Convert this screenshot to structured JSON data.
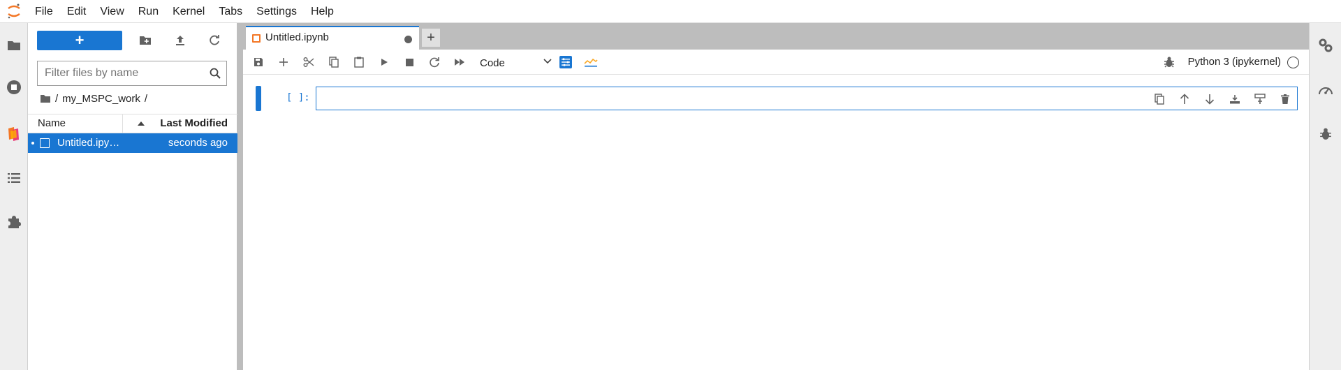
{
  "menubar": {
    "logo_icon": "jupyter-logo-icon",
    "items": [
      "File",
      "Edit",
      "View",
      "Run",
      "Kernel",
      "Tabs",
      "Settings",
      "Help"
    ]
  },
  "left_sidebar": {
    "icons": [
      "folder-icon",
      "running-sessions-icon",
      "extension-colored-icon",
      "table-of-contents-icon",
      "puzzle-extension-icon"
    ]
  },
  "file_browser": {
    "new_button_label": "+",
    "toolbar_icons": [
      "new-folder-icon",
      "upload-icon",
      "refresh-icon"
    ],
    "filter_placeholder": "Filter files by name",
    "breadcrumb": {
      "root_separator": "/",
      "folder": "my_MSPC_work",
      "trailing_separator": "/"
    },
    "columns": {
      "name": "Name",
      "last_modified": "Last Modified"
    },
    "files": [
      {
        "name": "Untitled.ipynb",
        "display_name": "Untitled.ipy…",
        "modified": "seconds ago",
        "selected": true
      }
    ]
  },
  "notebook": {
    "tab": {
      "title": "Untitled.ipynb",
      "add_label": "+"
    },
    "toolbar": {
      "icons": [
        "save-icon",
        "insert-cell-icon",
        "cut-icon",
        "copy-icon",
        "paste-icon",
        "run-icon",
        "stop-icon",
        "restart-icon",
        "run-all-icon"
      ],
      "cell_type": "Code",
      "kernel_name": "Python 3 (ipykernel)"
    },
    "cell": {
      "prompt": "[ ]:",
      "content": "",
      "tools": [
        "duplicate-cell-icon",
        "move-up-icon",
        "move-down-icon",
        "insert-below-icon",
        "insert-above-icon",
        "delete-cell-icon"
      ]
    }
  },
  "right_sidebar": {
    "icons": [
      "property-inspector-icon",
      "debugger-gauge-icon",
      "debug-bug-icon"
    ]
  },
  "colors": {
    "accent": "#1976d2",
    "jupyter_orange": "#f37726"
  }
}
